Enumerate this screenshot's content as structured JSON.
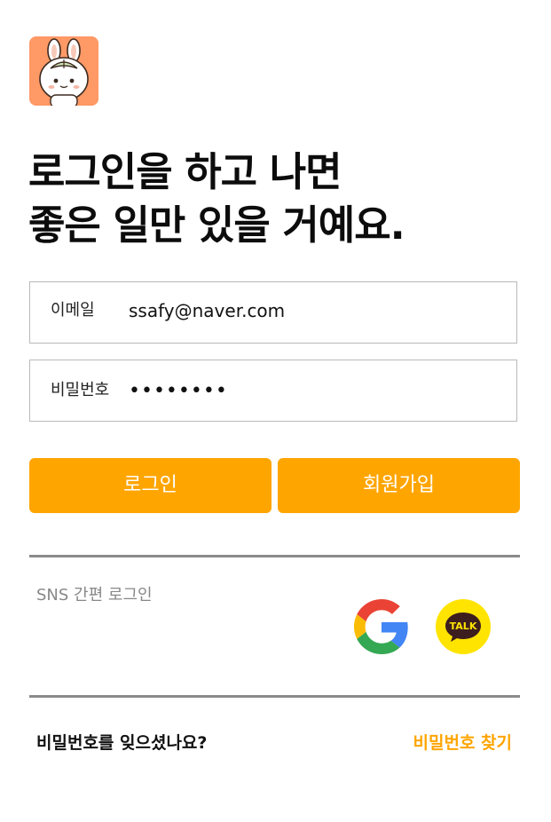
{
  "app": {
    "logo_icon": "bunny-mascot-icon",
    "logo_bg_color": "#FF9966"
  },
  "headline": {
    "line1": "로그인을 하고 나면",
    "line2": "좋은 일만 있을 거예요."
  },
  "form": {
    "email_label": "이메일",
    "email_value": "ssafy@naver.com",
    "password_label": "비밀번호",
    "password_value": "••••••••"
  },
  "buttons": {
    "login_label": "로그인",
    "signup_label": "회원가입",
    "accent_color": "#FFA500"
  },
  "sns": {
    "label": "SNS 간편 로그인",
    "providers": [
      {
        "icon": "google-icon"
      },
      {
        "icon": "kakao-talk-icon",
        "text": "TALK"
      }
    ]
  },
  "footer": {
    "forgot_text": "비밀번호를 잊으셨나요?",
    "find_link": "비밀번호 찾기"
  }
}
